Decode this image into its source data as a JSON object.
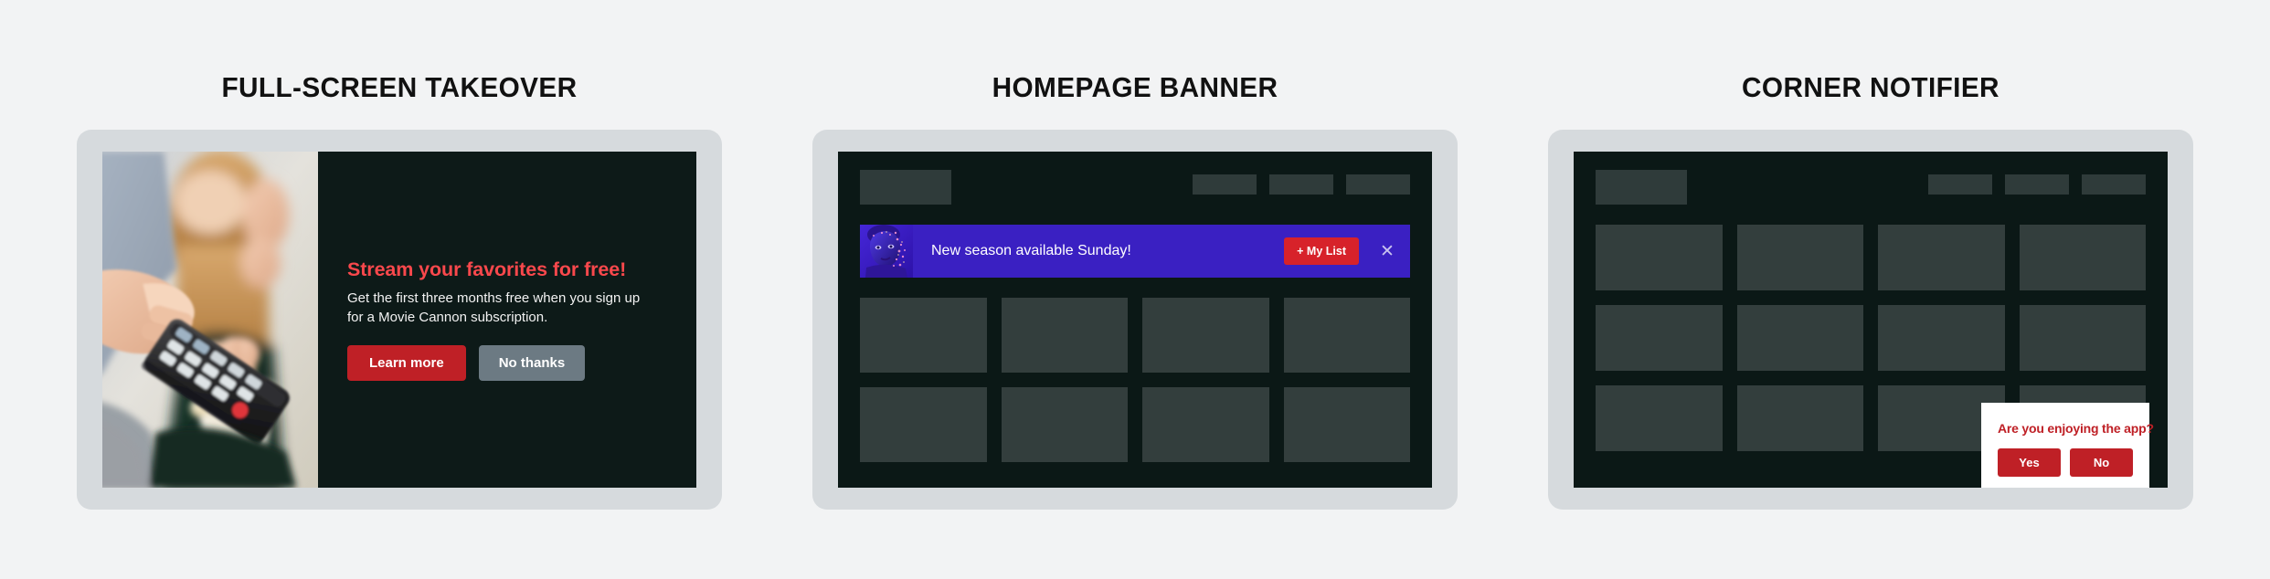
{
  "page": {
    "background_color": "#f2f3f4",
    "accent_red": "#bf2026",
    "heading_red": "#f9484c",
    "banner_purple": "#3a20c2",
    "screen_dark": "#0b1816",
    "tile_gray": "#333e3d",
    "frame_gray": "#d6dadd"
  },
  "panels": [
    {
      "title": "FULL-SCREEN TAKEOVER",
      "takeover": {
        "photo_alt": "hand-holding-tv-remote-photo",
        "headline": "Stream your favorites for free!",
        "body": "Get the first three months free when you sign up for a Movie Cannon subscription.",
        "primary_button": "Learn more",
        "secondary_button": "No thanks"
      }
    },
    {
      "title": "HOMEPAGE BANNER",
      "banner": {
        "thumb_alt": "portrait-thumbnail",
        "message": "New season available Sunday!",
        "cta_label": "+ My List",
        "close_label": "✕"
      }
    },
    {
      "title": "CORNER NOTIFIER",
      "notifier": {
        "question": "Are you enjoying the app?",
        "yes_label": "Yes",
        "no_label": "No"
      }
    }
  ]
}
